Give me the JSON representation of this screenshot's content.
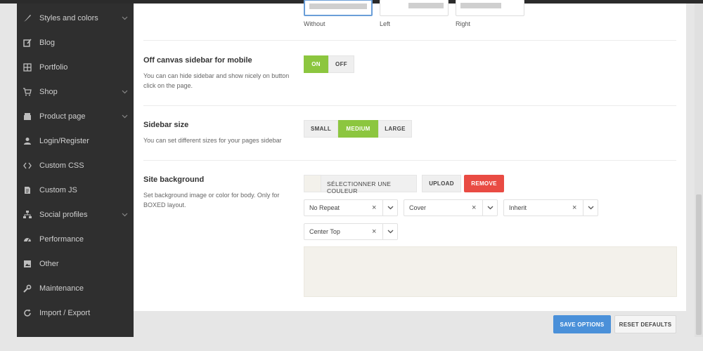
{
  "sidebar": {
    "items": [
      {
        "label": "Styles and colors",
        "icon": "brush-icon",
        "has_submenu": true
      },
      {
        "label": "Blog",
        "icon": "edit-icon",
        "has_submenu": false
      },
      {
        "label": "Portfolio",
        "icon": "grid-icon",
        "has_submenu": false
      },
      {
        "label": "Shop",
        "icon": "cart-icon",
        "has_submenu": true
      },
      {
        "label": "Product page",
        "icon": "store-icon",
        "has_submenu": true
      },
      {
        "label": "Login/Register",
        "icon": "user-icon",
        "has_submenu": false
      },
      {
        "label": "Custom CSS",
        "icon": "code-icon",
        "has_submenu": false
      },
      {
        "label": "Custom JS",
        "icon": "file-icon",
        "has_submenu": false
      },
      {
        "label": "Social profiles",
        "icon": "sitemap-icon",
        "has_submenu": true
      },
      {
        "label": "Performance",
        "icon": "dashboard-icon",
        "has_submenu": false
      },
      {
        "label": "Other",
        "icon": "image-icon",
        "has_submenu": false
      },
      {
        "label": "Maintenance",
        "icon": "wrench-icon",
        "has_submenu": false
      },
      {
        "label": "Import / Export",
        "icon": "refresh-icon",
        "has_submenu": false
      }
    ]
  },
  "layout_options": {
    "selected": "Without",
    "items": [
      {
        "label": "Without"
      },
      {
        "label": "Left"
      },
      {
        "label": "Right"
      }
    ]
  },
  "off_canvas": {
    "title": "Off canvas sidebar for mobile",
    "description": "You can can hide sidebar and show nicely on button click on the page.",
    "on_label": "ON",
    "off_label": "OFF",
    "value": "ON"
  },
  "sidebar_size": {
    "title": "Sidebar size",
    "description": "You can set different sizes for your pages sidebar",
    "options": [
      "SMALL",
      "MEDIUM",
      "LARGE"
    ],
    "selected": "MEDIUM"
  },
  "site_background": {
    "title": "Site background",
    "description": "Set background image or color for body. Only for BOXED layout.",
    "color_button": "SÉLECTIONNER UNE COULEUR",
    "upload_label": "UPLOAD",
    "remove_label": "REMOVE",
    "selects": [
      {
        "value": "No Repeat",
        "clear": "×"
      },
      {
        "value": "Cover",
        "clear": "×"
      },
      {
        "value": "Inherit",
        "clear": "×"
      },
      {
        "value": "Center Top",
        "clear": "×"
      }
    ]
  },
  "footer": {
    "save_label": "SAVE OPTIONS",
    "reset_label": "RESET DEFAULTS"
  },
  "colors": {
    "accent_green": "#8cc63f",
    "remove_red": "#e94b43",
    "save_blue": "#4a90d9",
    "sidebar_bg": "#2f2f2f",
    "preview_bg": "#f3f1eb"
  }
}
